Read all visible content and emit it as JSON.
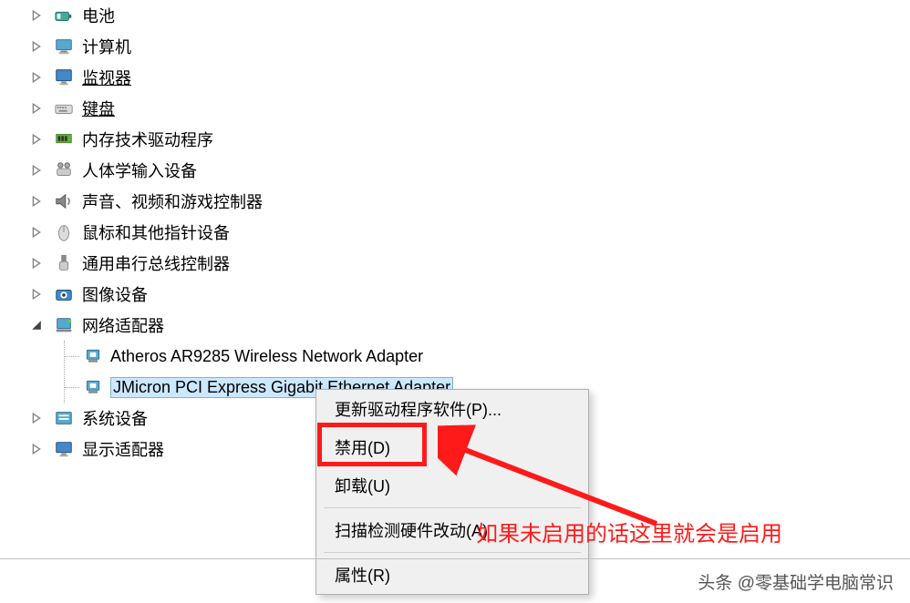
{
  "tree": {
    "items": [
      {
        "label": "电池",
        "icon": "battery"
      },
      {
        "label": "计算机",
        "icon": "computer"
      },
      {
        "label": "监视器",
        "icon": "monitor",
        "link": true
      },
      {
        "label": "键盘",
        "icon": "keyboard",
        "link": true
      },
      {
        "label": "内存技术驱动程序",
        "icon": "memory"
      },
      {
        "label": "人体学输入设备",
        "icon": "hid"
      },
      {
        "label": "声音、视频和游戏控制器",
        "icon": "sound"
      },
      {
        "label": "鼠标和其他指针设备",
        "icon": "mouse"
      },
      {
        "label": "通用串行总线控制器",
        "icon": "usb"
      },
      {
        "label": "图像设备",
        "icon": "imaging"
      },
      {
        "label": "网络适配器",
        "icon": "network",
        "expanded": true,
        "children": [
          {
            "label": "Atheros AR9285 Wireless Network Adapter",
            "icon": "netcard"
          },
          {
            "label": "JMicron PCI Express Gigabit Ethernet Adapter",
            "icon": "netcard",
            "selected": true
          }
        ]
      },
      {
        "label": "系统设备",
        "icon": "system"
      },
      {
        "label": "显示适配器",
        "icon": "display"
      }
    ]
  },
  "context_menu": {
    "items": [
      {
        "label": "更新驱动程序软件(P)..."
      },
      {
        "label": "禁用(D)",
        "highlighted": true
      },
      {
        "label": "卸载(U)"
      },
      {
        "sep": true
      },
      {
        "label": "扫描检测硬件改动(A)"
      },
      {
        "sep": true
      },
      {
        "label": "属性(R)"
      }
    ]
  },
  "annotation": "如果未启用的话这里就会是启用",
  "watermark": "头条 @零基础学电脑常识",
  "icons": {
    "expand_right": "▷",
    "expand_down": "◢"
  }
}
